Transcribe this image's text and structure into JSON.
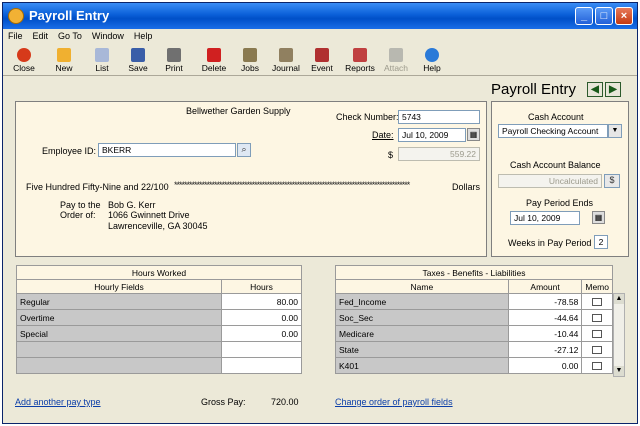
{
  "window": {
    "title": "Payroll Entry"
  },
  "menu": [
    "File",
    "Edit",
    "Go To",
    "Window",
    "Help"
  ],
  "toolbar": [
    {
      "label": "Close",
      "icon": "close-icon",
      "color": "#d63a1a"
    },
    {
      "label": "New",
      "icon": "new-icon",
      "color": "#f0b030"
    },
    {
      "label": "List",
      "icon": "list-icon",
      "color": "#a8b8d8"
    },
    {
      "label": "Save",
      "icon": "save-icon",
      "color": "#3a5ea8"
    },
    {
      "label": "Print",
      "icon": "print-icon",
      "color": "#707070"
    },
    {
      "label": "Delete",
      "icon": "delete-icon",
      "color": "#d02020"
    },
    {
      "label": "Jobs",
      "icon": "jobs-icon",
      "color": "#8a7a50"
    },
    {
      "label": "Journal",
      "icon": "journal-icon",
      "color": "#908060"
    },
    {
      "label": "Event",
      "icon": "event-icon",
      "color": "#b03030"
    },
    {
      "label": "Reports",
      "icon": "reports-icon",
      "color": "#c04040"
    },
    {
      "label": "Attach",
      "icon": "attach-icon",
      "color": "#b8b8b0"
    },
    {
      "label": "Help",
      "icon": "help-icon",
      "color": "#2a7ad8"
    }
  ],
  "header": {
    "title": "Payroll Entry"
  },
  "check": {
    "company": "Bellwether Garden Supply",
    "check_number_label": "Check Number:",
    "check_number": "5743",
    "date_label": "Date:",
    "date": "Jul 10, 2009",
    "amount_label": "$",
    "amount": "559.22",
    "employee_label": "Employee ID:",
    "employee_id": "BKERR",
    "amount_words": "Five Hundred Fifty-Nine and 22/100",
    "dollars_label": "Dollars",
    "pay_to_label": "Pay to the",
    "order_of_label": "Order of:",
    "payee_name": "Bob G. Kerr",
    "payee_street": "1066 Gwinnett Drive",
    "payee_city": "Lawrenceville, GA  30045"
  },
  "cash": {
    "account_label": "Cash Account",
    "account": "Payroll Checking Account",
    "balance_label": "Cash Account Balance",
    "balance": "Uncalculated",
    "period_ends_label": "Pay Period Ends",
    "period_ends": "Jul 10, 2009",
    "weeks_label": "Weeks in Pay Period",
    "weeks": "2"
  },
  "hours": {
    "title": "Hours Worked",
    "col_field": "Hourly Fields",
    "col_hours": "Hours",
    "rows": [
      {
        "field": "Regular",
        "hours": "80.00"
      },
      {
        "field": "Overtime",
        "hours": "0.00"
      },
      {
        "field": "Special",
        "hours": "0.00"
      },
      {
        "field": "",
        "hours": ""
      },
      {
        "field": "",
        "hours": ""
      }
    ]
  },
  "taxes": {
    "title": "Taxes - Benefits - Liabilities",
    "col_name": "Name",
    "col_amount": "Amount",
    "col_memo": "Memo",
    "rows": [
      {
        "name": "Fed_Income",
        "amount": "-78.58"
      },
      {
        "name": "Soc_Sec",
        "amount": "-44.64"
      },
      {
        "name": "Medicare",
        "amount": "-10.44"
      },
      {
        "name": "State",
        "amount": "-27.12"
      },
      {
        "name": "K401",
        "amount": "0.00"
      }
    ]
  },
  "footer": {
    "add_pay_type": "Add another pay type",
    "gross_pay_label": "Gross Pay:",
    "gross_pay": "720.00",
    "change_order": "Change order of payroll fields"
  }
}
